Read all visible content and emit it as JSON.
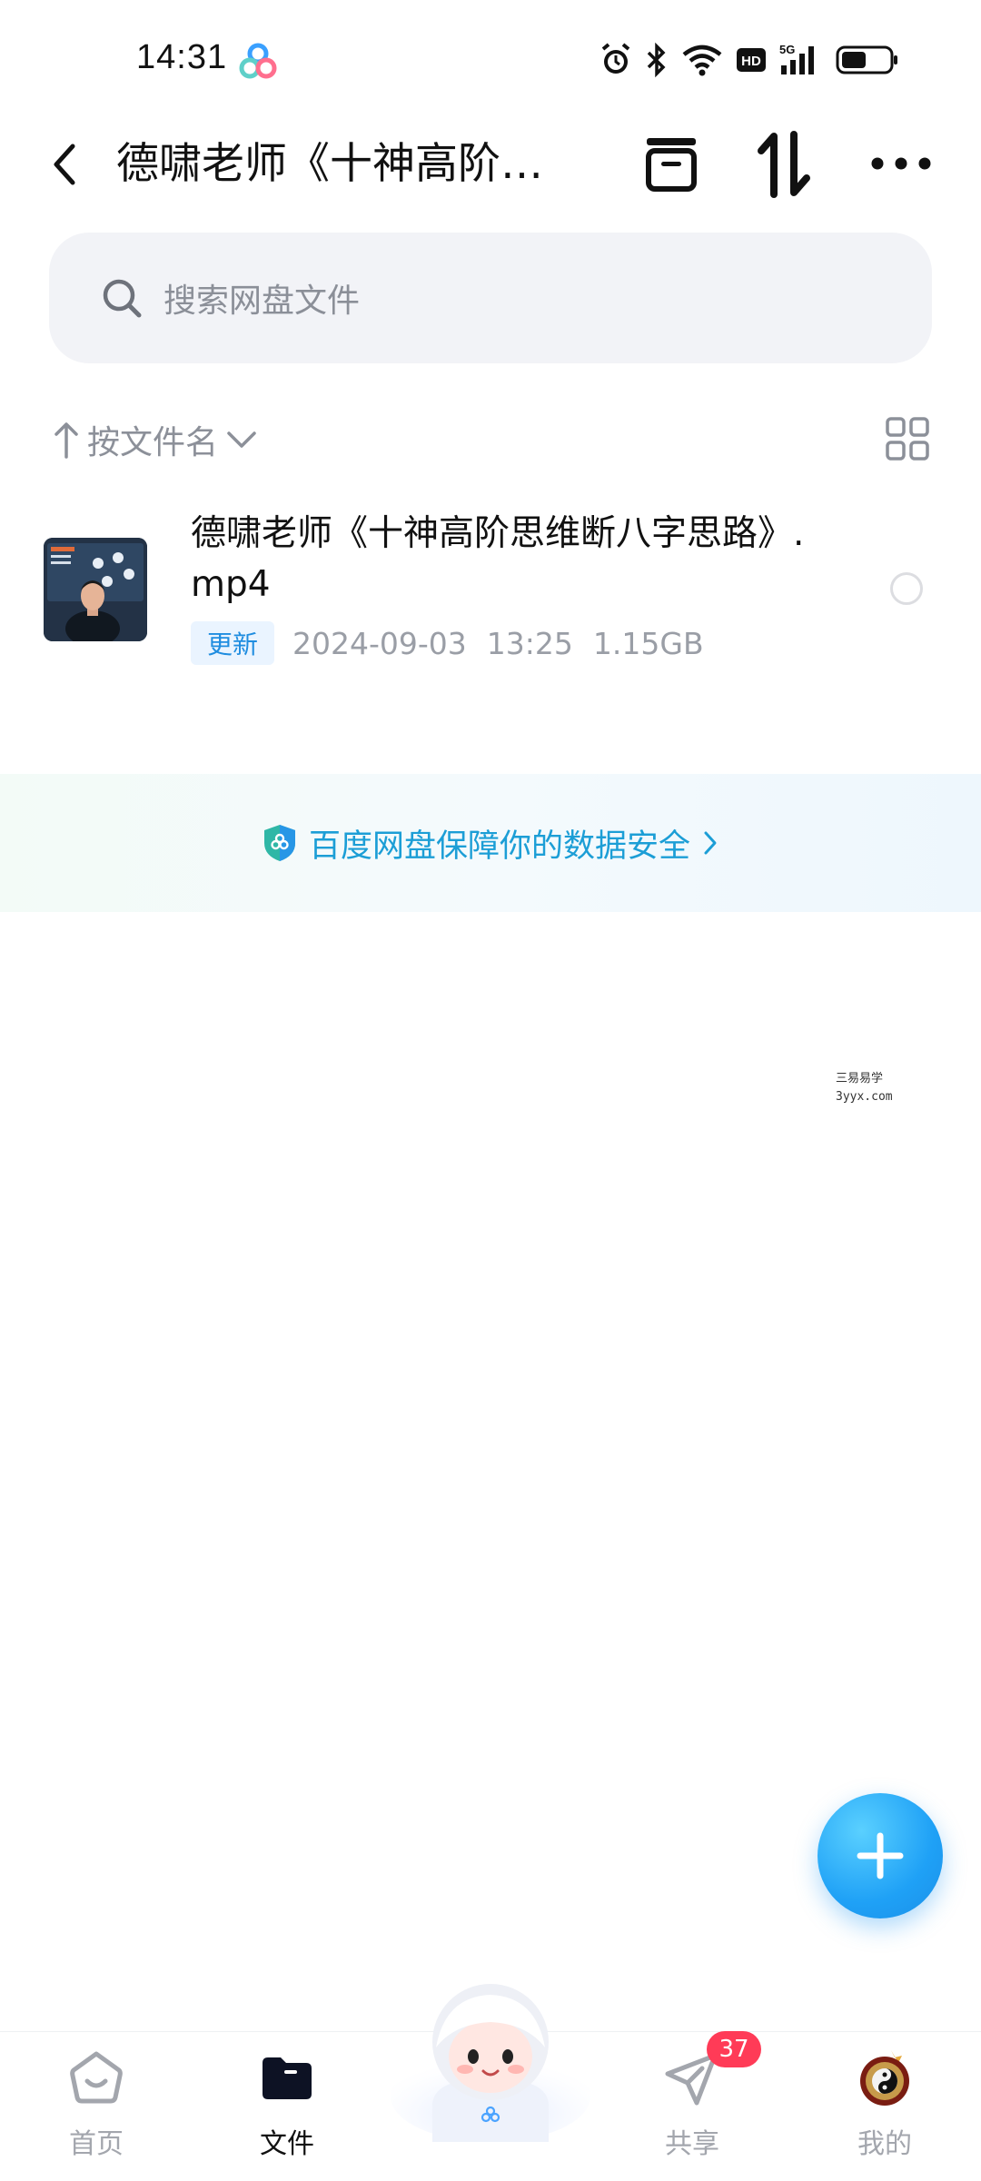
{
  "status_bar": {
    "time": "14:31",
    "app_icon": "baidu-netdisk-logo-icon",
    "icons": [
      "alarm-icon",
      "bluetooth-icon",
      "wifi-icon",
      "hd-icon",
      "5g-signal-icon",
      "battery-icon"
    ],
    "hd_label": "HD",
    "network_label": "5G"
  },
  "header": {
    "title": "德啸老师《十神高阶…",
    "icons": [
      "back-icon",
      "box-icon",
      "sort-icon",
      "more-icon"
    ]
  },
  "search": {
    "placeholder": "搜索网盘文件"
  },
  "sort": {
    "label": "按文件名"
  },
  "files": [
    {
      "name": "德啸老师《十神高阶思维断八字思路》.mp4",
      "badge": "更新",
      "date": "2024-09-03",
      "time": "13:25",
      "size": "1.15GB"
    }
  ],
  "security": {
    "text": "百度网盘保障你的数据安全"
  },
  "watermark": {
    "line1": "三易易学",
    "line2": "3yyx.com"
  },
  "nav": {
    "home": "首页",
    "files": "文件",
    "share": "共享",
    "mine": "我的",
    "share_badge": "37"
  },
  "colors": {
    "accent": "#1f8de0",
    "security_text": "#1c9ed6",
    "badge_red": "#ff3b57",
    "search_bg": "#f2f3f7"
  }
}
